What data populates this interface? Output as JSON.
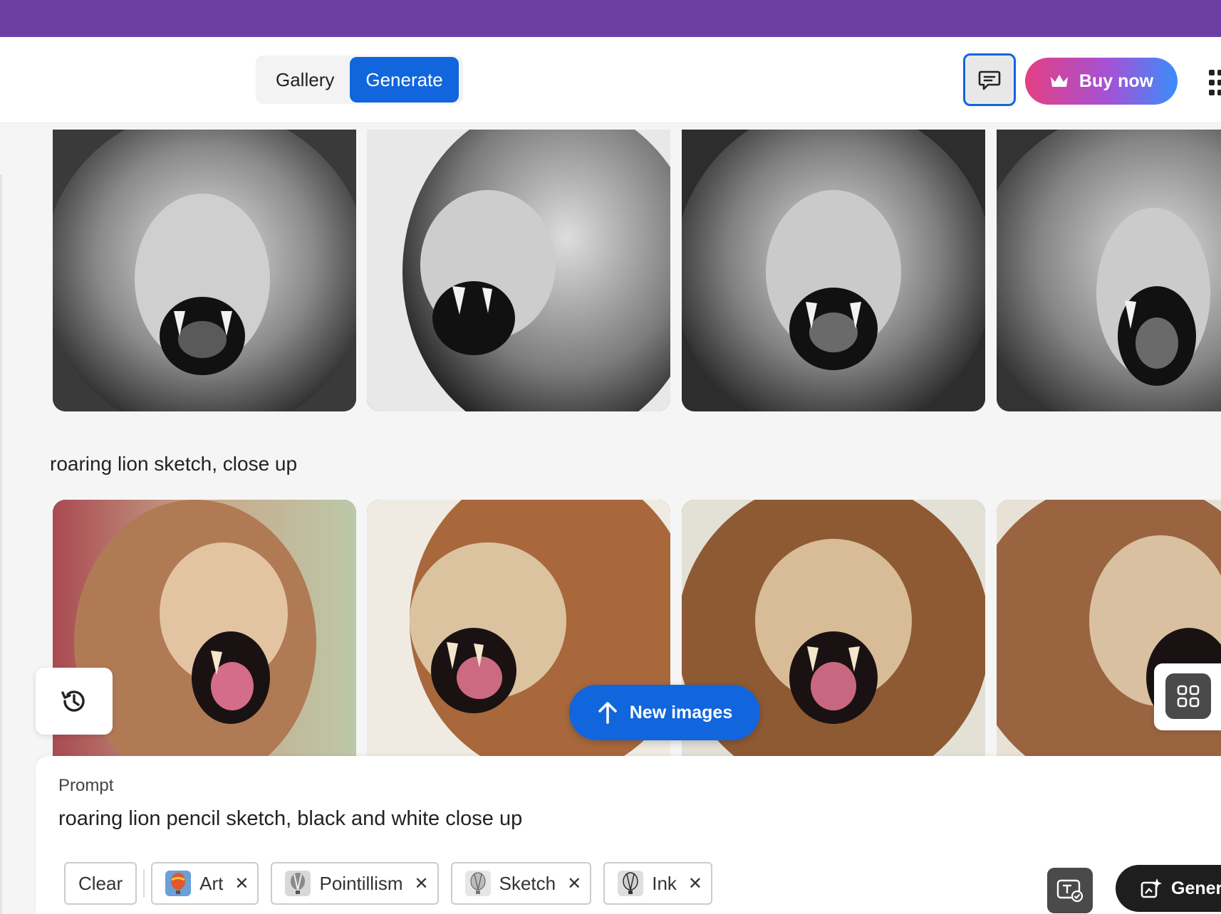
{
  "header": {
    "tabs": [
      {
        "label": "Gallery",
        "active": false
      },
      {
        "label": "Generate",
        "active": true
      }
    ],
    "feedback_icon": "chat-bubble-icon",
    "buy_label": "Buy now",
    "buy_icon": "crown-icon",
    "apps_icon": "apps-grid-icon"
  },
  "results": {
    "row2_label": "roaring lion sketch, close up"
  },
  "floating": {
    "history_icon": "history-icon",
    "new_images_label": "New images",
    "view_icon": "grid-view-icon"
  },
  "prompt": {
    "label": "Prompt",
    "value": "roaring lion pencil sketch, black and white close up",
    "clear_label": "Clear",
    "styles": [
      {
        "label": "Art"
      },
      {
        "label": "Pointillism"
      },
      {
        "label": "Sketch"
      },
      {
        "label": "Ink"
      }
    ],
    "generate_label": "Generate"
  },
  "colors": {
    "topbar": "#6e3fa3",
    "accent": "#1166dd",
    "buy_gradient_start": "#e43f83",
    "buy_gradient_end": "#3a8dfa"
  }
}
